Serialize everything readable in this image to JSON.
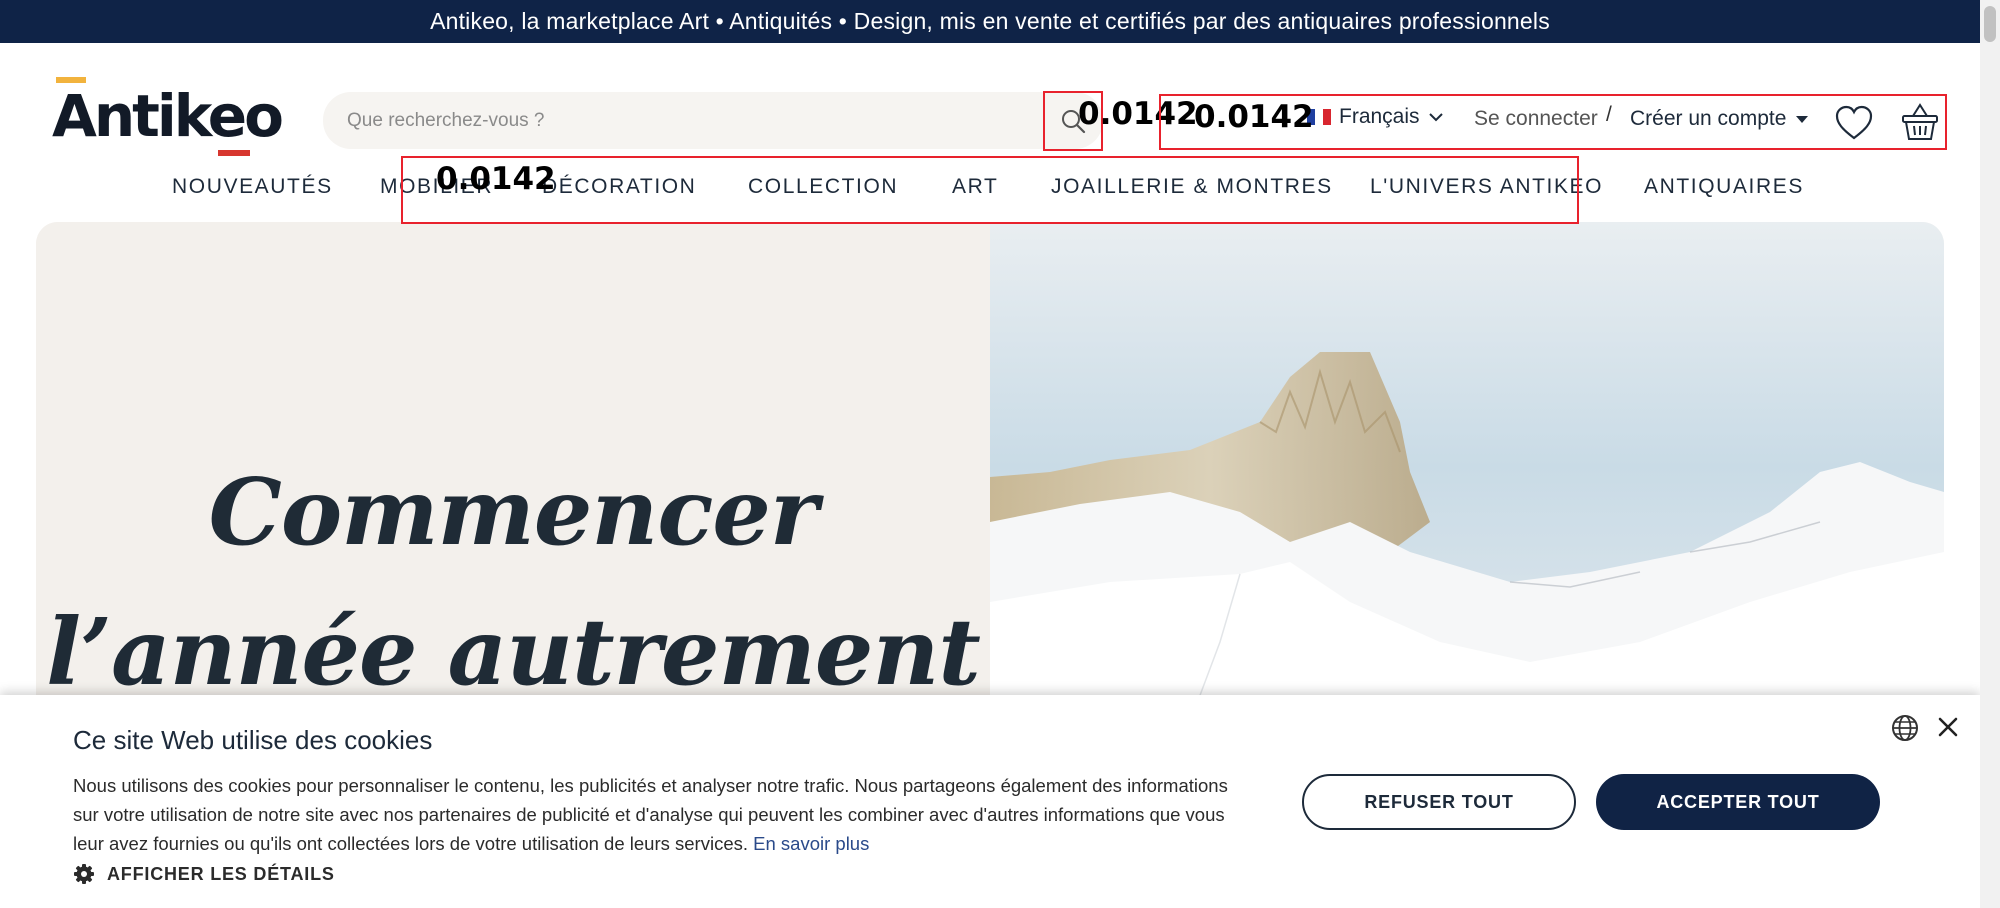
{
  "announcement": "Antikeo, la marketplace Art • Antiquités • Design, mis en vente et certifiés par des antiquaires professionnels",
  "logo": {
    "text": "Antikeo"
  },
  "search": {
    "placeholder": "Que recherchez-vous ?"
  },
  "overlay_labels": {
    "search_box": "0.0142",
    "header_box": "0.0142",
    "nav_box": "0.0142"
  },
  "header": {
    "language": "Français",
    "login": "Se connecter",
    "separator": "/",
    "create_account": "Créer un compte"
  },
  "nav": {
    "items": [
      "NOUVEAUTÉS",
      "MOBILIER",
      "DÉCORATION",
      "COLLECTION",
      "ART",
      "JOAILLERIE & MONTRES",
      "L'UNIVERS ANTIKEO",
      "ANTIQUAIRES"
    ]
  },
  "hero": {
    "title_line1": "Commencer",
    "title_line2": "l’année autrement"
  },
  "cookie": {
    "title": "Ce site Web utilise des cookies",
    "body": "Nous utilisons des cookies pour personnaliser le contenu, les publicités et analyser notre trafic. Nous partageons également des informations sur votre utilisation de notre site avec nos partenaires de publicité et d'analyse qui peuvent les combiner avec d'autres informations que vous leur avez fournies ou qu'ils ont collectées lors de votre utilisation de leurs services.",
    "learn_more": "En savoir plus",
    "details": "AFFICHER LES DÉTAILS",
    "refuse": "REFUSER TOUT",
    "accept": "ACCEPTER TOUT"
  },
  "colors": {
    "announcement_bg": "#0f2347",
    "accept_bg": "#102345",
    "logo_yellow": "#f2b33d",
    "logo_red": "#d7362f",
    "annotation_red": "#e8222d",
    "hero_left_bg": "#f3f0ec"
  },
  "icons": [
    "search-icon",
    "flag-fr-icon",
    "chevron-down-icon",
    "caret-down-icon",
    "heart-icon",
    "basket-icon",
    "gear-icon",
    "globe-icon",
    "close-icon"
  ]
}
